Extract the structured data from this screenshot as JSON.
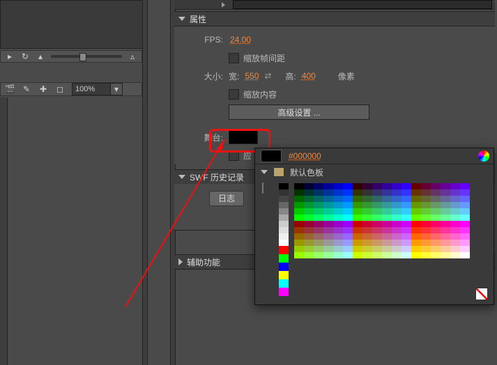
{
  "left": {
    "zoom": "100%"
  },
  "props": {
    "section_title": "属性",
    "fps_label": "FPS:",
    "fps_value": "24.00",
    "scale_frame_cb": "缩放帧间距",
    "size_label": "大小:",
    "width_label": "宽:",
    "width_value": "550",
    "height_label": "高:",
    "height_value": "400",
    "px_label": "像素",
    "scale_content_cb": "缩放内容",
    "adv_btn": "高级设置 ...",
    "stage_label": "舞台:",
    "apply_cb_prefix": "应"
  },
  "swf": {
    "title": "SWF 历史记录",
    "log_tab": "日志"
  },
  "aux": {
    "title": "辅助功能"
  },
  "colorpicker": {
    "hex": "#000000",
    "palette_label": "默认色板"
  }
}
